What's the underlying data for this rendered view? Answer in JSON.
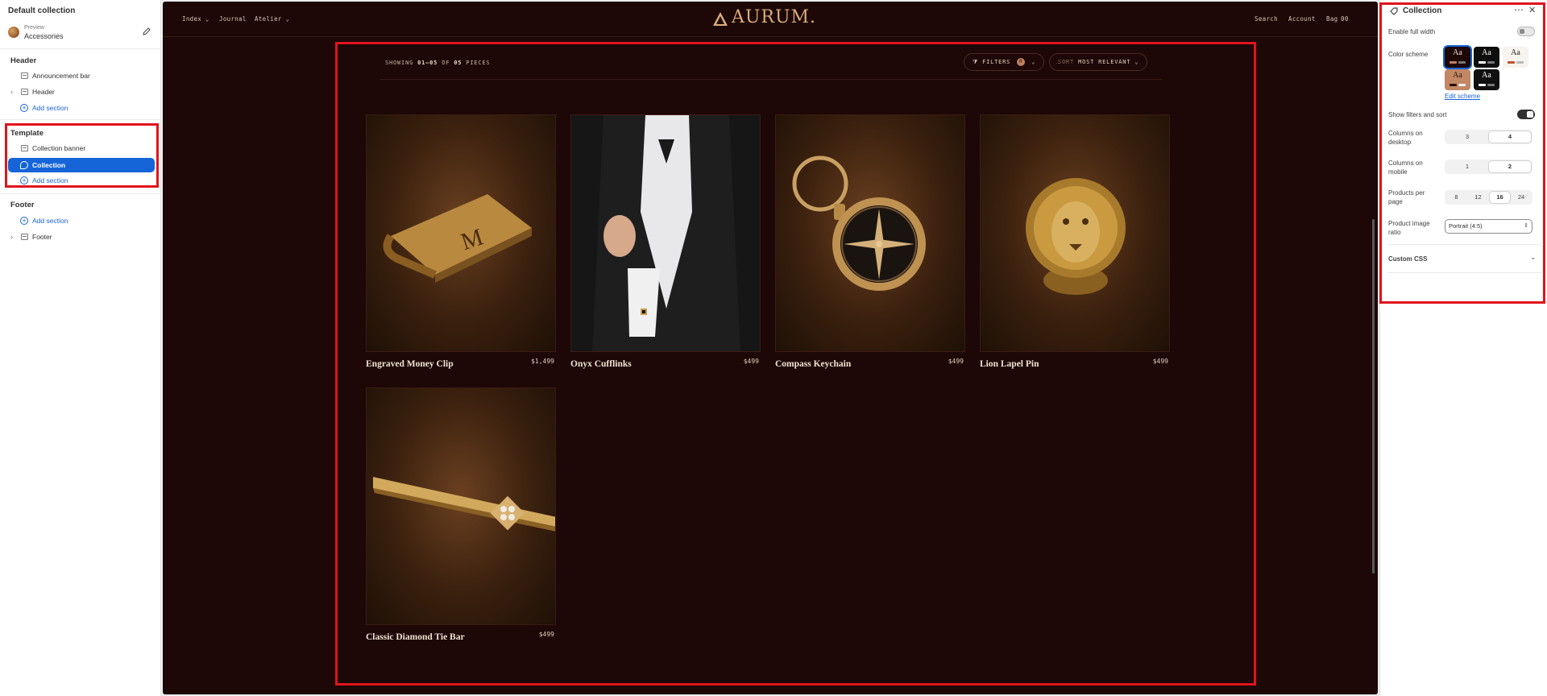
{
  "left_sidebar": {
    "title": "Default collection",
    "preview": {
      "label": "Preview",
      "value": "Accessories"
    },
    "groups": {
      "header": {
        "title": "Header",
        "items": [
          "Announcement bar",
          "Header"
        ],
        "add": "Add section"
      },
      "template": {
        "title": "Template",
        "items": [
          "Collection banner",
          "Collection"
        ],
        "add": "Add section"
      },
      "footer": {
        "title": "Footer",
        "items": [
          "Footer"
        ],
        "add": "Add section"
      }
    }
  },
  "store": {
    "nav": [
      "Index",
      "Journal",
      "Atelier"
    ],
    "logo": "AURUM.",
    "utility": [
      "Search",
      "Account",
      "Bag",
      "00"
    ],
    "showing_prefix": "SHOWING",
    "showing_range": "01–05",
    "showing_of": "OF",
    "showing_total": "05",
    "showing_suffix": "PIECES",
    "filters_label": "FILTERS",
    "filters_count": "0",
    "sort_prefix": "SORT",
    "sort_value": "MOST RELEVANT",
    "products": [
      {
        "name": "Engraved Money Clip",
        "price": "$1,499",
        "icon": "money-clip"
      },
      {
        "name": "Onyx Cufflinks",
        "price": "$499",
        "icon": "cufflinks"
      },
      {
        "name": "Compass Keychain",
        "price": "$499",
        "icon": "compass"
      },
      {
        "name": "Lion Lapel Pin",
        "price": "$499",
        "icon": "lion"
      },
      {
        "name": "Classic Diamond Tie Bar",
        "price": "$499",
        "icon": "tie-bar"
      }
    ]
  },
  "right_panel": {
    "title": "Collection",
    "enable_full_width": "Enable full width",
    "color_scheme": "Color scheme",
    "swatch_text": "Aa",
    "edit_scheme": "Edit scheme",
    "show_filters": "Show filters and sort",
    "columns_desktop": {
      "label": "Columns on desktop",
      "options": [
        "3",
        "4"
      ],
      "selected": "4"
    },
    "columns_mobile": {
      "label": "Columns on mobile",
      "options": [
        "1",
        "2"
      ],
      "selected": "2"
    },
    "products_per_page": {
      "label": "Products per page",
      "options": [
        "8",
        "12",
        "16",
        "24"
      ],
      "selected": "16"
    },
    "image_ratio": {
      "label": "Product image ratio",
      "value": "Portrait (4:5)"
    },
    "custom_css": "Custom CSS"
  },
  "colors": {
    "store_bg": "#1d0707",
    "gold": "#d9ac7a",
    "editor_accent": "#1565d8",
    "highlight": "#e0141b"
  }
}
